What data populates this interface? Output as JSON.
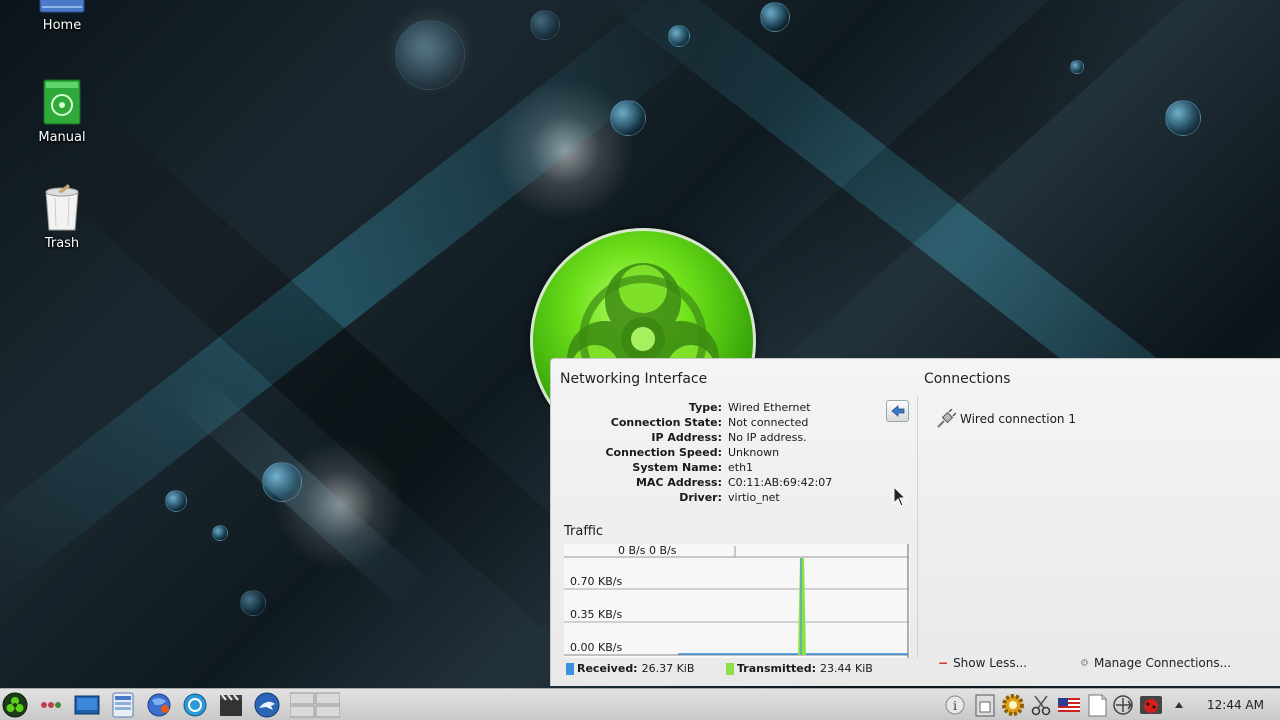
{
  "desktop": {
    "icons": [
      {
        "label": "Home",
        "glyph": "folder-home-icon"
      },
      {
        "label": "Manual",
        "glyph": "manual-book-icon"
      },
      {
        "label": "Trash",
        "glyph": "trash-icon"
      }
    ]
  },
  "network_popup": {
    "interface_title": "Networking Interface",
    "connections_title": "Connections",
    "details": [
      {
        "key": "Type:",
        "value": "Wired Ethernet"
      },
      {
        "key": "Connection State:",
        "value": "Not connected"
      },
      {
        "key": "IP Address:",
        "value": "No IP address."
      },
      {
        "key": "Connection Speed:",
        "value": "Unknown"
      },
      {
        "key": "System Name:",
        "value": "eth1"
      },
      {
        "key": "MAC Address:",
        "value": "C0:11:AB:69:42:07"
      },
      {
        "key": "Driver:",
        "value": "virtio_net"
      }
    ],
    "traffic": {
      "title": "Traffic",
      "header_readout": "0 B/s 0 B/s",
      "y_ticks": [
        "0.70 KB/s",
        "0.35 KB/s",
        "0.00 KB/s"
      ],
      "received_label": "Received:",
      "received_value": "26.37 KiB",
      "transmitted_label": "Transmitted:",
      "transmitted_value": "23.44 KiB",
      "received_color": "#3d8fe0",
      "transmitted_color": "#8ee04a"
    },
    "connections": [
      {
        "label": "Wired connection 1",
        "icon": "wired-plug-icon"
      }
    ],
    "show_less_label": "Show Less...",
    "manage_connections_label": "Manage Connections..."
  },
  "taskbar": {
    "clock": "12:44 AM",
    "launchers": [
      "app-menu-icon",
      "dots-icon",
      "desktop-icon",
      "file-manager-icon",
      "web-browser-icon",
      "finder-icon",
      "video-player-icon",
      "shark-icon"
    ],
    "tray": [
      "info-icon",
      "clipboard-manager-icon",
      "settings-gear-icon",
      "scissors-icon",
      "flag-us-icon",
      "notes-icon",
      "network-icon",
      "ladybug-icon",
      "arrow-up-icon"
    ]
  },
  "colors": {
    "accent_green": "#6fe21b",
    "popup_bg": "#eeeeee"
  }
}
